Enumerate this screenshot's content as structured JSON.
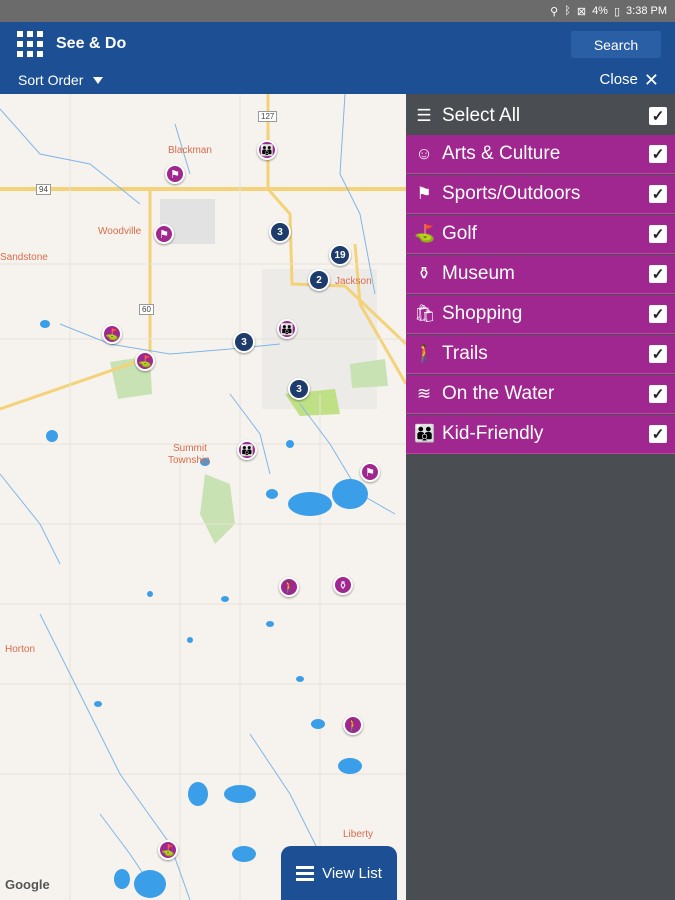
{
  "statusbar": {
    "battery": "4%",
    "time": "3:38 PM",
    "icons": [
      "location-icon",
      "bluetooth-icon",
      "no-signal-icon",
      "battery-icon"
    ]
  },
  "appbar": {
    "title": "See & Do",
    "search_label": "Search"
  },
  "subbar": {
    "sort_label": "Sort Order",
    "close_label": "Close"
  },
  "map": {
    "labels": {
      "blackman": "Blackman",
      "woodville": "Woodville",
      "sandstone": "Sandstone",
      "jackson": "Jackson",
      "summit": "Summit",
      "township": "Township",
      "horton": "Horton",
      "liberty": "Liberty"
    },
    "road_shields": {
      "r127": "127",
      "r94": "94",
      "r60": "60"
    },
    "clusters": {
      "c1": "3",
      "c2": "19",
      "c3": "2",
      "c4": "3",
      "c5": "3"
    },
    "google": "Google",
    "view_list_label": "View List"
  },
  "panel": {
    "select_all": "Select All",
    "categories": [
      {
        "label": "Arts & Culture",
        "icon": "masks-icon",
        "checked": true
      },
      {
        "label": "Sports/Outdoors",
        "icon": "sports-icon",
        "checked": true
      },
      {
        "label": "Golf",
        "icon": "golf-icon",
        "checked": true
      },
      {
        "label": "Museum",
        "icon": "museum-icon",
        "checked": true
      },
      {
        "label": "Shopping",
        "icon": "shopping-bag-icon",
        "checked": true
      },
      {
        "label": "Trails",
        "icon": "hiker-icon",
        "checked": true
      },
      {
        "label": "On the Water",
        "icon": "water-icon",
        "checked": true
      },
      {
        "label": "Kid-Friendly",
        "icon": "family-icon",
        "checked": true
      }
    ],
    "colors": {
      "category_bg": "#a0278f",
      "panel_bg": "#4a4d52",
      "appbar": "#1c4f93",
      "cluster": "#1d3c6b"
    }
  }
}
